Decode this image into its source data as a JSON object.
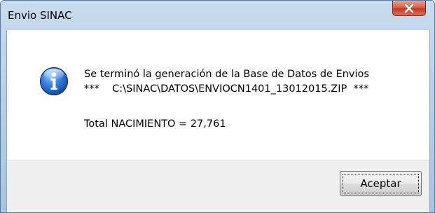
{
  "window": {
    "title": "Envio SINAC"
  },
  "dialog": {
    "message_line1": "Se terminó la generación de la Base de Datos de Envios",
    "message_line2": "***    C:\\SINAC\\DATOS\\ENVIOCN1401_13012015.ZIP  ***",
    "message_line3": "Total NACIMIENTO = 27,761",
    "icon": "info-icon",
    "accept_label": "Aceptar"
  },
  "colors": {
    "titlebar": "#b7cfe7",
    "close_button": "#c23b22",
    "info_icon": "#2a6fc9",
    "button_area": "#f0f0f0"
  }
}
